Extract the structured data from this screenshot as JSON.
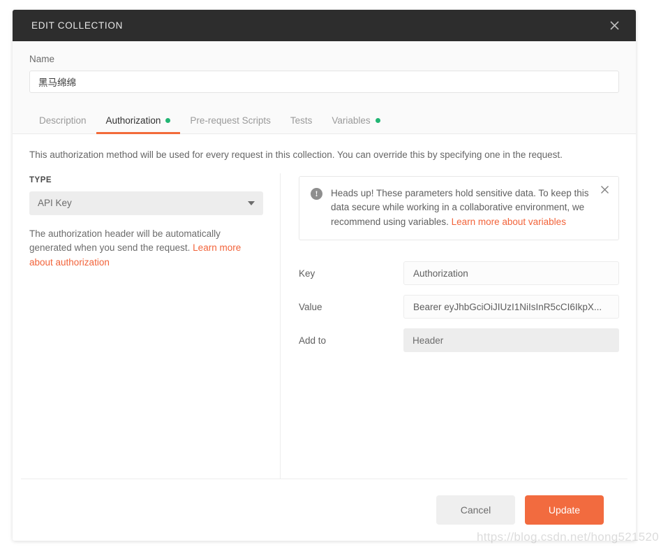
{
  "modal": {
    "title": "EDIT COLLECTION",
    "close_icon": "close-icon"
  },
  "name_field": {
    "label": "Name",
    "value": "黑马绵绵",
    "placeholder": "Name"
  },
  "tabs": [
    {
      "label": "Description",
      "active": false,
      "dot": false
    },
    {
      "label": "Authorization",
      "active": true,
      "dot": true
    },
    {
      "label": "Pre-request Scripts",
      "active": false,
      "dot": false
    },
    {
      "label": "Tests",
      "active": false,
      "dot": false
    },
    {
      "label": "Variables",
      "active": false,
      "dot": true
    }
  ],
  "intro": "This authorization method will be used for every request in this collection. You can override this by specifying one in the request.",
  "type_section": {
    "label": "TYPE",
    "selected": "API Key",
    "helper_prefix": "The authorization header will be automatically generated when you send the request. ",
    "helper_link": "Learn more about authorization"
  },
  "banner": {
    "icon": "exclamation-icon",
    "text": "Heads up! These parameters hold sensitive data. To keep this data secure while working in a collaborative environment, we recommend using variables. ",
    "link": "Learn more about variables",
    "close_icon": "close-icon"
  },
  "fields": {
    "key": {
      "label": "Key",
      "value": "Authorization",
      "placeholder": "Key"
    },
    "value": {
      "label": "Value",
      "value": "Bearer eyJhbGciOiJIUzI1NiIsInR5cCI6IkpX...",
      "placeholder": "Value"
    },
    "add_to": {
      "label": "Add to",
      "selected": "Header"
    }
  },
  "footer": {
    "cancel_label": "Cancel",
    "update_label": "Update"
  },
  "watermark": "https://blog.csdn.net/hong521520",
  "colors": {
    "accent": "#f26b3f",
    "header_bg": "#2d2d2d",
    "dot_green": "#21b573",
    "link": "#f2633a"
  }
}
